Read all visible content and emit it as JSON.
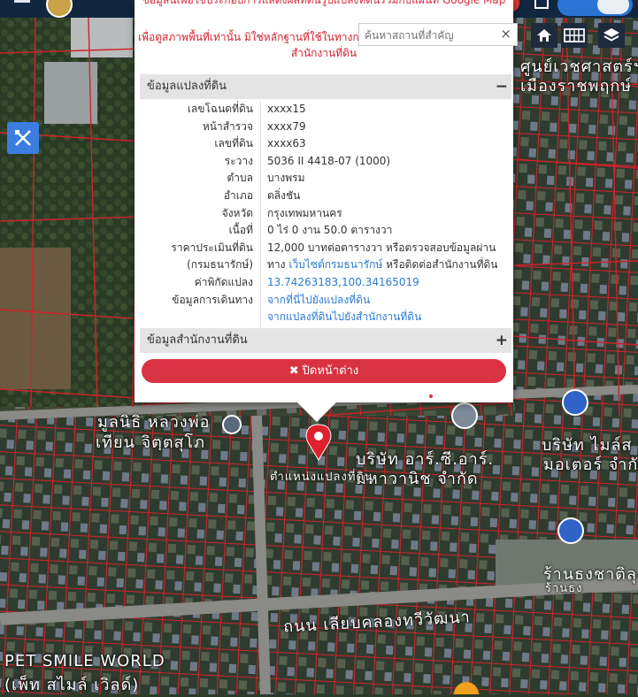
{
  "search": {
    "placeholder": "ค้นหาสถานที่สำคัญ",
    "clear_icon": "×"
  },
  "warning": {
    "line1": "ข้อมูลนี้เพื่อใช้ประกอบการแสดงผลที่ดินรูปแปลงที่ดินร่วมกับแผนที่ Google Map",
    "line2": "เพื่อดูสภาพพื้นที่เท่านั้น มิใช่หลักฐานที่ใช้ในทางกฎหมาย",
    "line3": "สำนักงานที่ดิน"
  },
  "section1": {
    "title": "ข้อมูลแปลงที่ดิน",
    "toggle": "−"
  },
  "section2": {
    "title": "ข้อมูลสำนักงานที่ดิน",
    "toggle": "+"
  },
  "parcel": {
    "deed_label": "เลขโฉนดที่ดิน",
    "deed": "xxxx15",
    "survey_label": "หน้าสำรวจ",
    "survey": "xxxx79",
    "land_label": "เลขที่ดิน",
    "land": "xxxx63",
    "sheet_label": "ระวาง",
    "sheet": "5036 II 4418-07 (1000)",
    "subdistrict_label": "ตำบล",
    "subdistrict": "บางพรม",
    "district_label": "อำเภอ",
    "district": "ตลิ่งชัน",
    "province_label": "จังหวัด",
    "province": "กรุงเทพมหานคร",
    "area_label": "เนื้อที่",
    "area": "0 ไร่ 0 งาน 50.0 ตารางวา",
    "price_label": "ราคาประเมินที่ดิน",
    "price": "12,000 บาทต่อตารางวา หรือตรวจสอบข้อมูลผ่าน",
    "dept_label": "(กรมธนารักษ์)",
    "dept_prefix": "ทาง",
    "dept_link": "เว็บไซต์กรมธนารักษ์",
    "dept_suffix": "หรือติดต่อสำนักงานที่ดิน",
    "coord_label": "ค่าพิกัดแปลง",
    "coord": "13.74263183,100.34165019",
    "travel_label": "ข้อมูลการเดินทาง",
    "travel1": "จากที่นี่ไปยังแปลงที่ดิน",
    "travel2": "จากแปลงที่ดินไปยังสำนักงานที่ดิน"
  },
  "close_button": {
    "icon": "✖",
    "label": "ปิดหน้าต่าง"
  },
  "map_labels": {
    "foundation": "มูลนิธิ หลวงพ่อ",
    "foundation2": "เทียน จิตฺตสุโภ",
    "company": "บริษัท อาร์.ซี.อาร์.",
    "company2": "มหาวานิช จำกัด",
    "road": "ถนน เลียบคลองทวีวัฒนา",
    "petsmile": "PET SMILE WORLD",
    "petsmile2": "(เพ็ท สไมล์ เวิลด์)",
    "tr_company": "บริษัท ไมล์ส",
    "tr_company2": "มอเตอร์ จำกัด",
    "tr_bank": "ร้านธงชาติลุง",
    "tr_bank2": "ร้านธง",
    "tr_top": "ศูนย์เวชศาสตร์ฯ",
    "tr_top2": "เมืองราชพฤกษ์",
    "marker_label": "ตำแหน่งแปลงที่ดิน"
  },
  "icons": {
    "home": "home-icon",
    "grid": "grid-icon",
    "layers": "layers-icon",
    "tool": "ruler-pencil-icon"
  }
}
